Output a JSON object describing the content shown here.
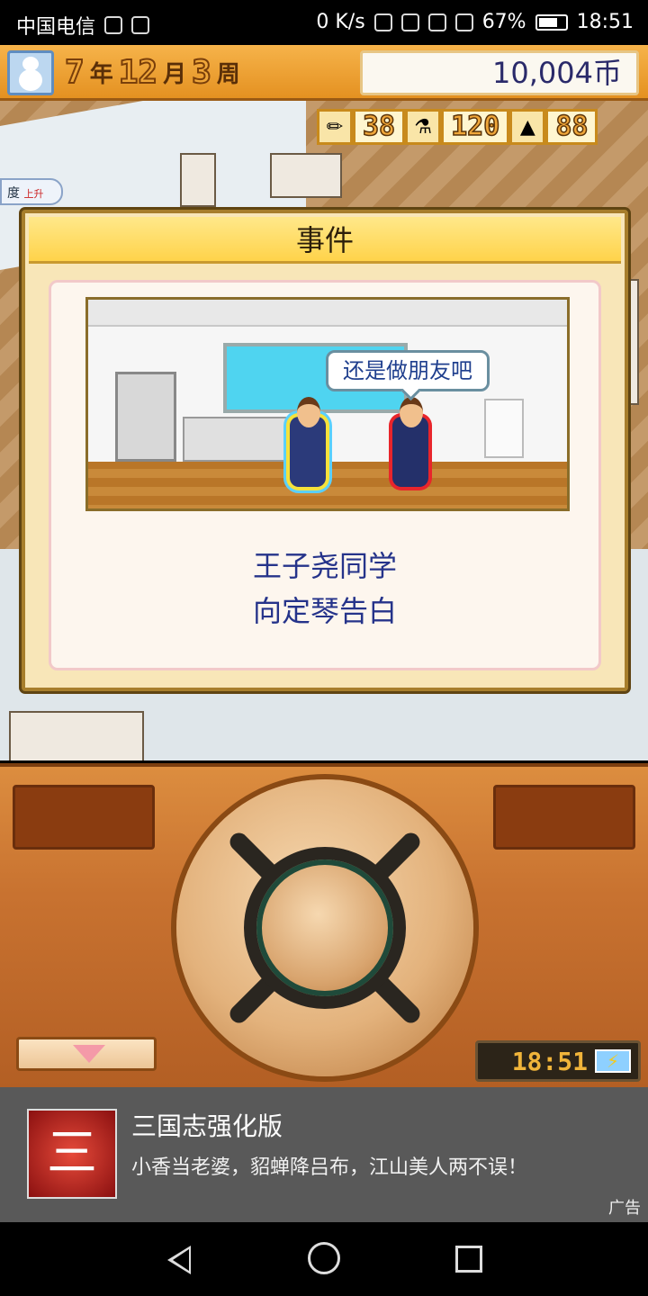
{
  "status_bar": {
    "carrier": "中国电信",
    "net_speed": "0 K/s",
    "battery": "67%",
    "time": "18:51"
  },
  "top_bar": {
    "year": "7",
    "year_unit": "年",
    "month": "12",
    "month_unit": "月",
    "week": "3",
    "week_unit": "周",
    "money": "10,004币"
  },
  "resources": {
    "pencil": "38",
    "flask": "120",
    "weight": "88"
  },
  "map_badge": "度",
  "map_badge_sub": "上升",
  "event_dialog": {
    "title": "事件",
    "speech": "还是做朋友吧",
    "message_line1": "王子尧同学",
    "message_line2": "向定琴告白"
  },
  "console": {
    "clock": "18:51"
  },
  "ad": {
    "logo_text": "三",
    "title": "三国志强化版",
    "desc": "小香当老婆，貂蝉降吕布，江山美人两不误！",
    "label": "广告"
  },
  "colors": {
    "accent_orange": "#e49121",
    "dialog_gold": "#ffd34a",
    "text_blue": "#25338a"
  }
}
